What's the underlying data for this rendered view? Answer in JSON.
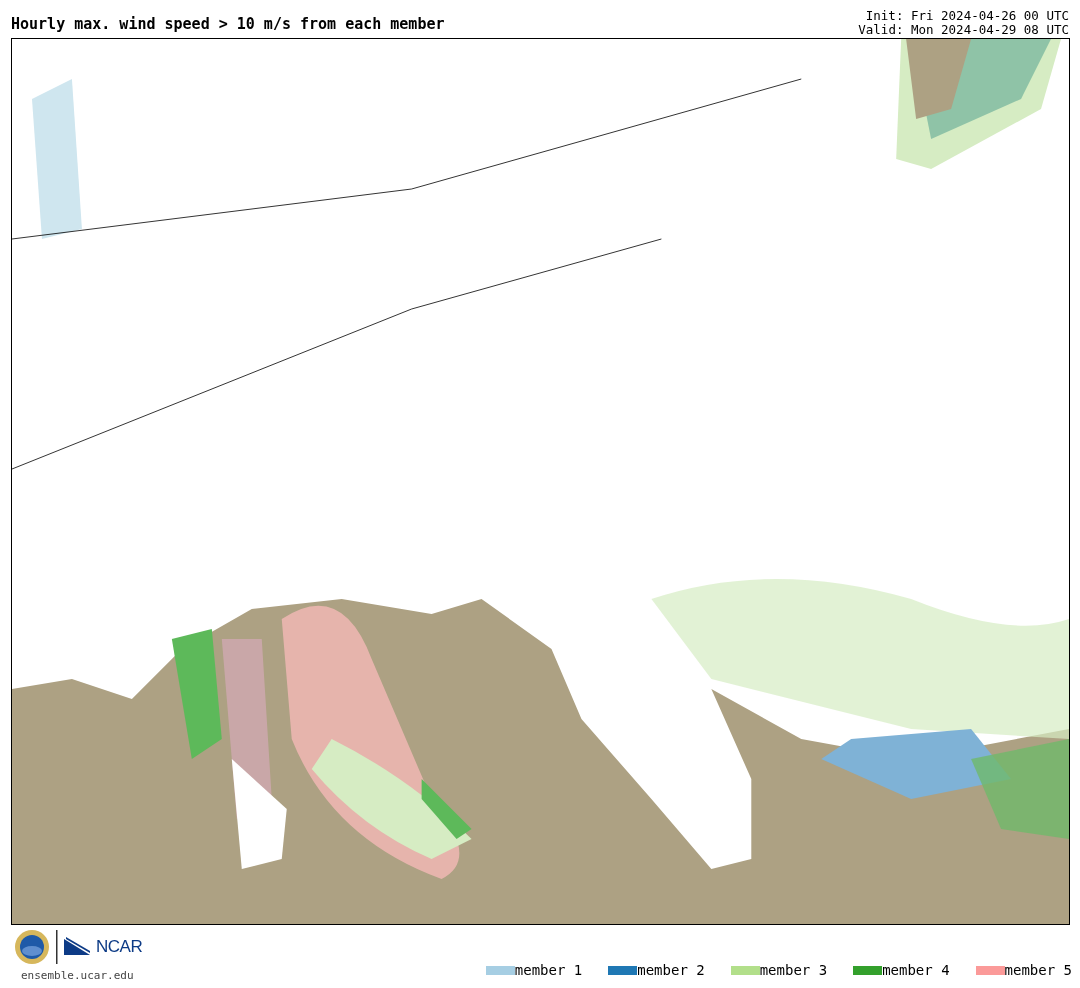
{
  "title": "Hourly max. wind speed > 10 m/s from each member",
  "init": "Init: Fri 2024-04-26 00 UTC",
  "valid": "Valid: Mon 2024-04-29 08 UTC",
  "logo_text": "NCAR",
  "site": "ensemble.ucar.edu",
  "legend": [
    {
      "label": "member 1",
      "color": "#a6cee3"
    },
    {
      "label": "member 2",
      "color": "#1f78b4"
    },
    {
      "label": "member 3",
      "color": "#b2df8a"
    },
    {
      "label": "member 4",
      "color": "#33a02c"
    },
    {
      "label": "member 5",
      "color": "#fb9a99"
    }
  ]
}
